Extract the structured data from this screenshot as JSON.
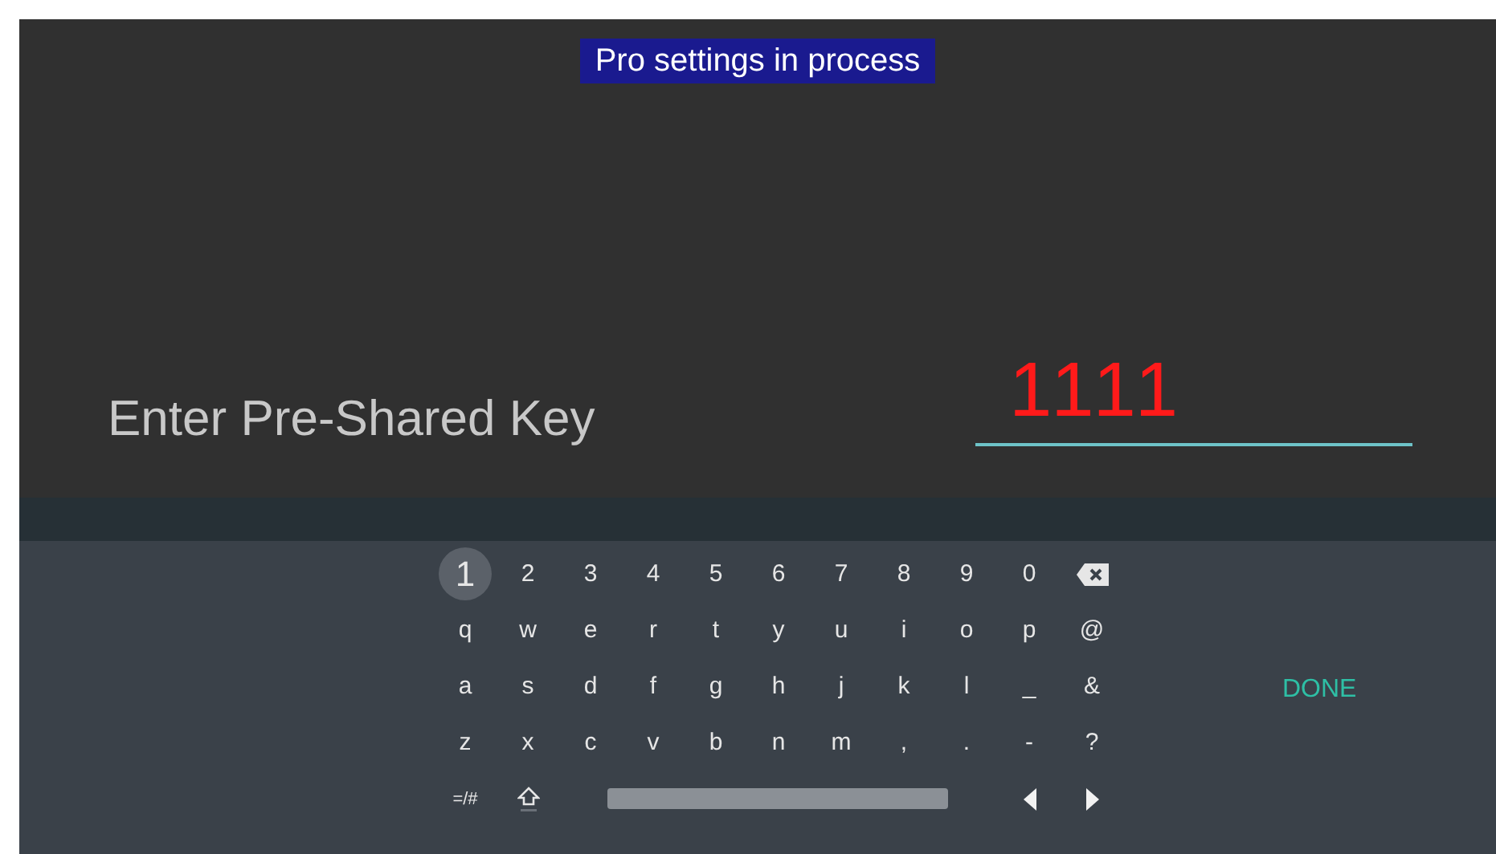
{
  "banner": "Pro settings in process",
  "prompt": "Enter Pre-Shared Key",
  "field": {
    "value": "1111"
  },
  "keyboard": {
    "rows": [
      [
        {
          "kind": "char",
          "label": "1",
          "selected": true
        },
        {
          "kind": "char",
          "label": "2",
          "selected": false
        },
        {
          "kind": "char",
          "label": "3",
          "selected": false
        },
        {
          "kind": "char",
          "label": "4",
          "selected": false
        },
        {
          "kind": "char",
          "label": "5",
          "selected": false
        },
        {
          "kind": "char",
          "label": "6",
          "selected": false
        },
        {
          "kind": "char",
          "label": "7",
          "selected": false
        },
        {
          "kind": "char",
          "label": "8",
          "selected": false
        },
        {
          "kind": "char",
          "label": "9",
          "selected": false
        },
        {
          "kind": "char",
          "label": "0",
          "selected": false
        },
        {
          "kind": "backspace",
          "selected": false
        }
      ],
      [
        {
          "kind": "char",
          "label": "q",
          "selected": false
        },
        {
          "kind": "char",
          "label": "w",
          "selected": false
        },
        {
          "kind": "char",
          "label": "e",
          "selected": false
        },
        {
          "kind": "char",
          "label": "r",
          "selected": false
        },
        {
          "kind": "char",
          "label": "t",
          "selected": false
        },
        {
          "kind": "char",
          "label": "y",
          "selected": false
        },
        {
          "kind": "char",
          "label": "u",
          "selected": false
        },
        {
          "kind": "char",
          "label": "i",
          "selected": false
        },
        {
          "kind": "char",
          "label": "o",
          "selected": false
        },
        {
          "kind": "char",
          "label": "p",
          "selected": false
        },
        {
          "kind": "char",
          "label": "@",
          "selected": false
        }
      ],
      [
        {
          "kind": "char",
          "label": "a",
          "selected": false
        },
        {
          "kind": "char",
          "label": "s",
          "selected": false
        },
        {
          "kind": "char",
          "label": "d",
          "selected": false
        },
        {
          "kind": "char",
          "label": "f",
          "selected": false
        },
        {
          "kind": "char",
          "label": "g",
          "selected": false
        },
        {
          "kind": "char",
          "label": "h",
          "selected": false
        },
        {
          "kind": "char",
          "label": "j",
          "selected": false
        },
        {
          "kind": "char",
          "label": "k",
          "selected": false
        },
        {
          "kind": "char",
          "label": "l",
          "selected": false
        },
        {
          "kind": "char",
          "label": "_",
          "selected": false
        },
        {
          "kind": "char",
          "label": "&",
          "selected": false
        }
      ],
      [
        {
          "kind": "char",
          "label": "z",
          "selected": false
        },
        {
          "kind": "char",
          "label": "x",
          "selected": false
        },
        {
          "kind": "char",
          "label": "c",
          "selected": false
        },
        {
          "kind": "char",
          "label": "v",
          "selected": false
        },
        {
          "kind": "char",
          "label": "b",
          "selected": false
        },
        {
          "kind": "char",
          "label": "n",
          "selected": false
        },
        {
          "kind": "char",
          "label": "m",
          "selected": false
        },
        {
          "kind": "char",
          "label": ",",
          "selected": false
        },
        {
          "kind": "char",
          "label": ".",
          "selected": false
        },
        {
          "kind": "char",
          "label": "-",
          "selected": false
        },
        {
          "kind": "char",
          "label": "?",
          "selected": false
        }
      ],
      [
        {
          "kind": "mode",
          "label": "=/#",
          "selected": false
        },
        {
          "kind": "shift",
          "selected": false
        },
        {
          "kind": "space",
          "selected": false
        },
        {
          "kind": "left",
          "selected": false
        },
        {
          "kind": "right",
          "selected": false
        }
      ]
    ]
  },
  "done": "DONE"
}
